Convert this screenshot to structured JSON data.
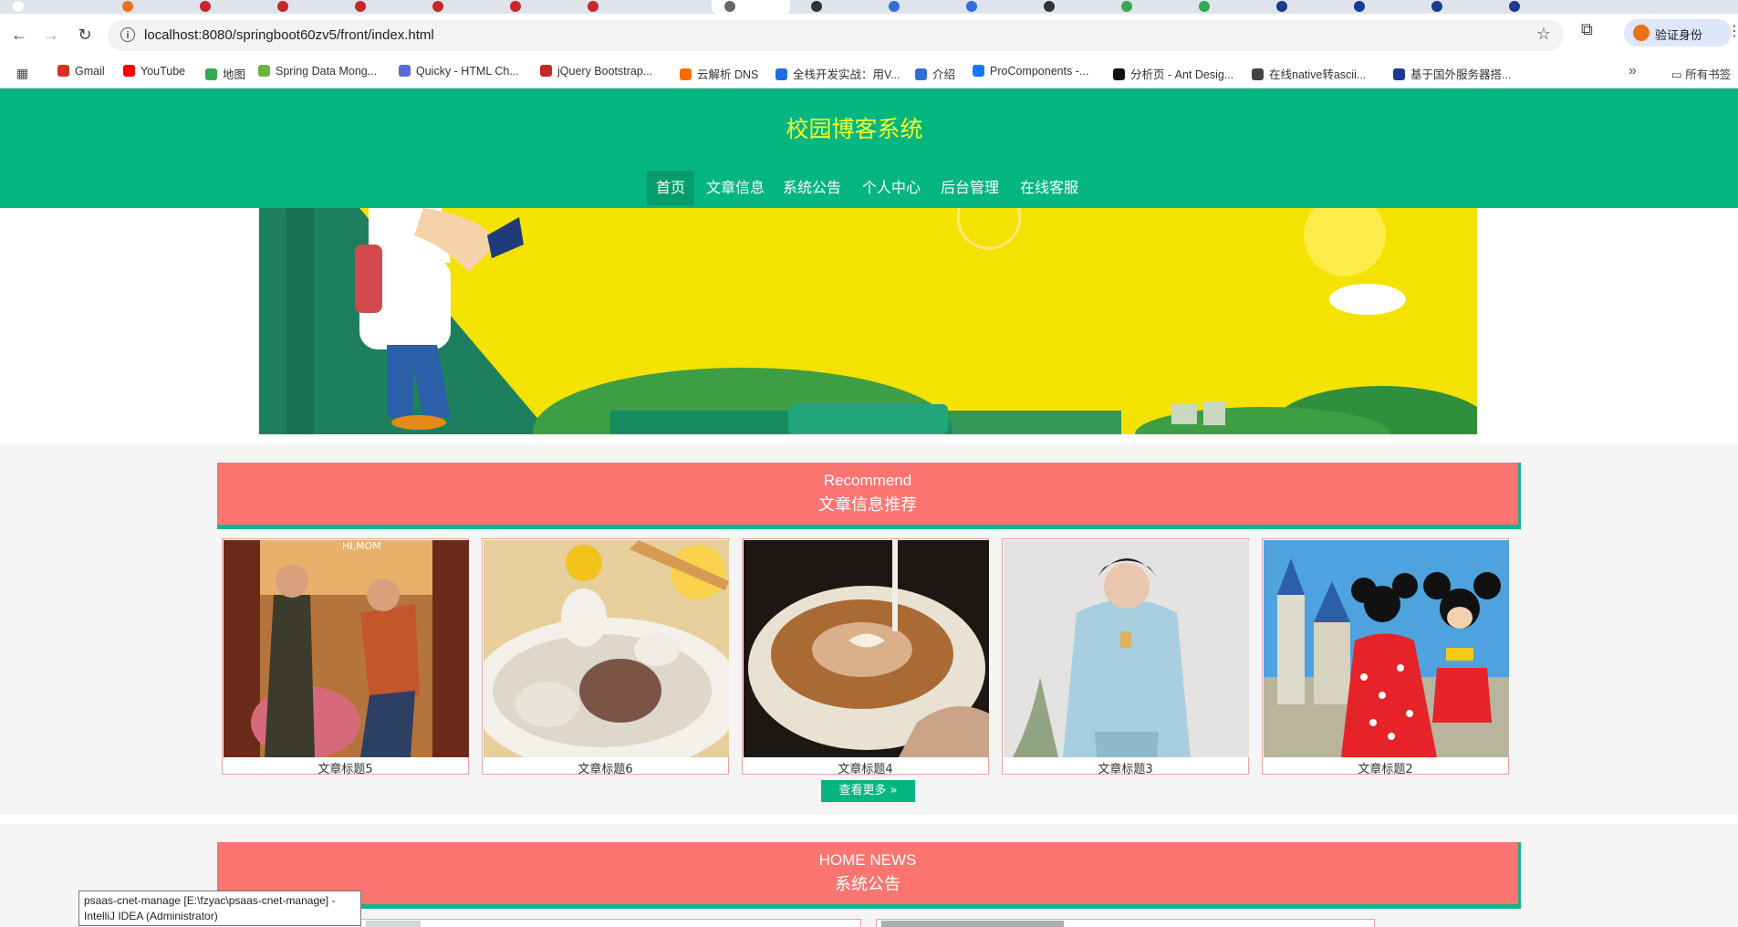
{
  "browser": {
    "url": "localhost:8080/springboot60zv5/front/index.html",
    "profile_button": "验证身份",
    "bookmarks": [
      {
        "label": "Gmail",
        "color": "#d93025"
      },
      {
        "label": "YouTube",
        "color": "#ff0000"
      },
      {
        "label": "地图",
        "color": "#34a853"
      },
      {
        "label": "Spring Data Mong...",
        "color": "#6db33f"
      },
      {
        "label": "Quicky - HTML Ch...",
        "color": "#5b6bd6"
      },
      {
        "label": "jQuery Bootstrap...",
        "color": "#c62828"
      },
      {
        "label": "云解析 DNS",
        "color": "#ff6a00"
      },
      {
        "label": "全栈开发实战：用V...",
        "color": "#1e6fd9"
      },
      {
        "label": "介绍",
        "color": "#2f6fd6"
      },
      {
        "label": "ProComponents -...",
        "color": "#1677ff"
      },
      {
        "label": "分析页 - Ant Desig...",
        "color": "#111111"
      },
      {
        "label": "在线native转ascii...",
        "color": "#444444"
      },
      {
        "label": "基于国外服务器搭...",
        "color": "#1a3b8f"
      }
    ],
    "all_bookmarks": "所有书签"
  },
  "site": {
    "title": "校园博客系统",
    "nav": [
      "首页",
      "文章信息",
      "系统公告",
      "个人中心",
      "后台管理",
      "在线客服"
    ]
  },
  "recommend": {
    "en": "Recommend",
    "cn": "文章信息推荐",
    "items": [
      {
        "caption": "文章标题5"
      },
      {
        "caption": "文章标题6"
      },
      {
        "caption": "文章标题4"
      },
      {
        "caption": "文章标题3"
      },
      {
        "caption": "文章标题2"
      }
    ],
    "more": "查看更多"
  },
  "news": {
    "en": "HOME NEWS",
    "cn": "系统公告"
  },
  "tooltip": {
    "line1": "psaas-cnet-manage [E:\\fzyac\\psaas-cnet-manage] -",
    "line2": "IntelliJ IDEA (Administrator)"
  },
  "colors": {
    "header_green": "#05b680",
    "title_yellow": "#f5ff2a",
    "section_red": "#fd7571"
  }
}
